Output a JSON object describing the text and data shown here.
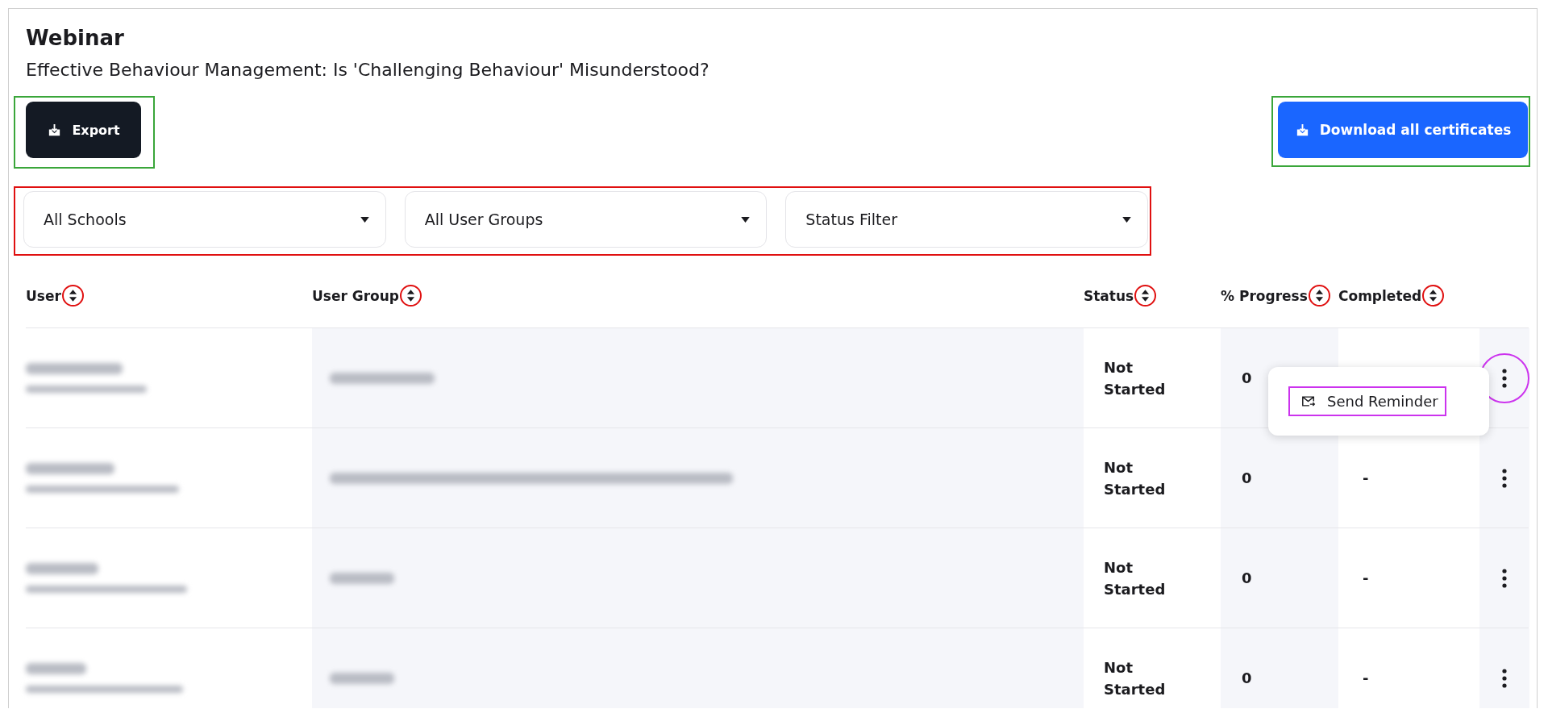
{
  "page": {
    "title": "Webinar",
    "subtitle": "Effective Behaviour Management: Is 'Challenging Behaviour' Misunderstood?"
  },
  "actions": [
    {
      "kind": "export",
      "label": "Export",
      "annotation": {
        "color": "#3aa63a"
      }
    },
    {
      "kind": "download",
      "label": "Download all certificates",
      "annotation": {
        "color": "#3aa63a"
      }
    }
  ],
  "filters": {
    "annotation": {
      "color": "#e01010"
    },
    "items": [
      {
        "label": "All Schools"
      },
      {
        "label": "All User Groups"
      },
      {
        "label": "Status Filter"
      }
    ]
  },
  "table": {
    "columns": [
      {
        "label": "User",
        "sortable": true,
        "annotation": {
          "color": "#e01010"
        }
      },
      {
        "label": "User Group",
        "sortable": true,
        "annotation": {
          "color": "#e01010"
        }
      },
      {
        "label": "Status",
        "sortable": true,
        "annotation": {
          "color": "#e01010"
        }
      },
      {
        "label": "% Progress",
        "sortable": true,
        "annotation": {
          "color": "#e01010"
        }
      },
      {
        "label": "Completed",
        "sortable": true,
        "annotation": {
          "color": "#e01010"
        }
      }
    ],
    "rows": [
      {
        "status": "Not Started",
        "progress": "0",
        "menu_open": true,
        "annotation": {
          "color": "#cc33ee"
        },
        "menu": [
          {
            "label": "Send Reminder",
            "annotation": {
              "color": "#cc33ee"
            }
          }
        ]
      },
      {
        "status": "Not Started",
        "progress": "0",
        "completed": "-",
        "menu_open": false
      },
      {
        "status": "Not Started",
        "progress": "0",
        "completed": "-",
        "menu_open": false
      },
      {
        "status": "Not Started",
        "progress": "0",
        "completed": "-",
        "menu_open": false
      }
    ]
  }
}
